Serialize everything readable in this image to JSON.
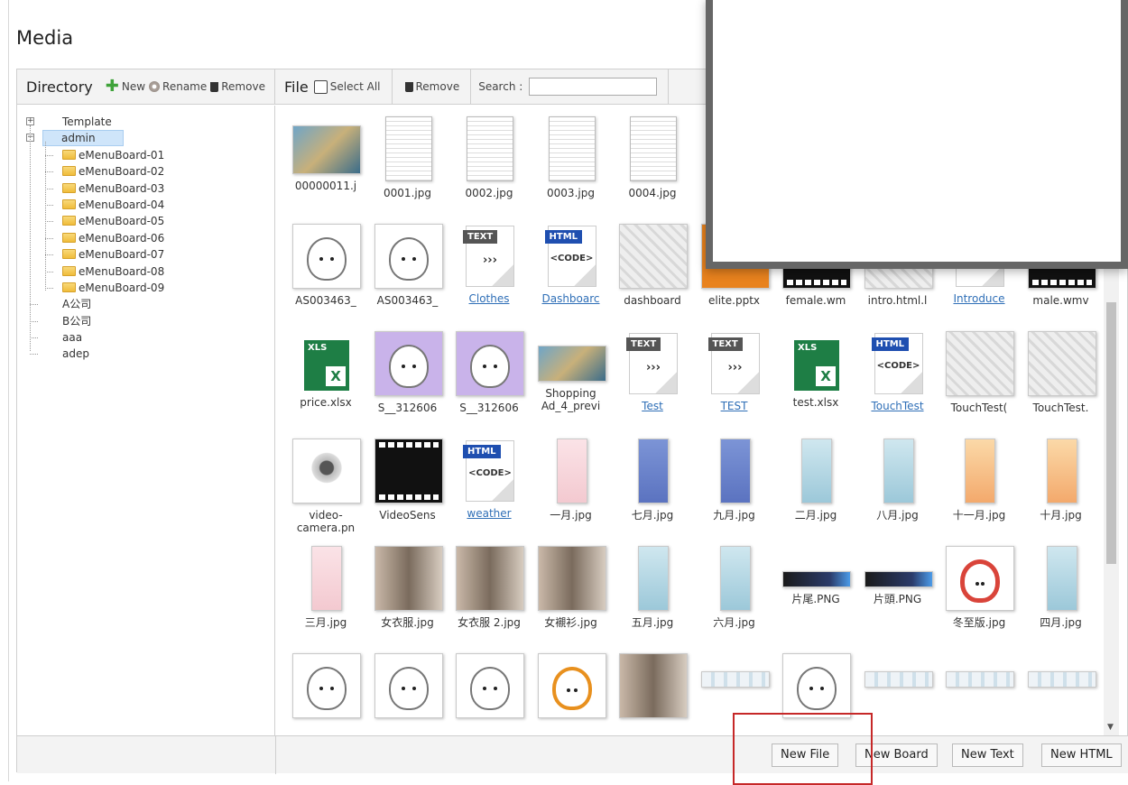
{
  "page": {
    "title": "Media"
  },
  "directory": {
    "title": "Directory",
    "new_label": "New",
    "rename_label": "Rename",
    "remove_label": "Remove",
    "tree": [
      {
        "label": "Template",
        "level": 0,
        "expander": "+"
      },
      {
        "label": "admin",
        "level": 0,
        "expander": "-",
        "selected": true
      },
      {
        "label": "eMenuBoard-01",
        "level": 1,
        "folder": true
      },
      {
        "label": "eMenuBoard-02",
        "level": 1,
        "folder": true
      },
      {
        "label": "eMenuBoard-03",
        "level": 1,
        "folder": true
      },
      {
        "label": "eMenuBoard-04",
        "level": 1,
        "folder": true
      },
      {
        "label": "eMenuBoard-05",
        "level": 1,
        "folder": true
      },
      {
        "label": "eMenuBoard-06",
        "level": 1,
        "folder": true
      },
      {
        "label": "eMenuBoard-07",
        "level": 1,
        "folder": true
      },
      {
        "label": "eMenuBoard-08",
        "level": 1,
        "folder": true
      },
      {
        "label": "eMenuBoard-09",
        "level": 1,
        "folder": true
      },
      {
        "label": "A公司",
        "level": 0
      },
      {
        "label": "B公司",
        "level": 0
      },
      {
        "label": "aaa",
        "level": 0
      },
      {
        "label": "adep",
        "level": 0
      }
    ]
  },
  "file": {
    "title": "File",
    "select_all_label": "Select All",
    "remove_label": "Remove",
    "search_label": "Search :",
    "search_value": ""
  },
  "files": [
    {
      "caption": "00000011.j",
      "kind": "photo"
    },
    {
      "caption": "0001.jpg",
      "kind": "doc"
    },
    {
      "caption": "0002.jpg",
      "kind": "doc"
    },
    {
      "caption": "0003.jpg",
      "kind": "doc"
    },
    {
      "caption": "0004.jpg",
      "kind": "doc"
    },
    {
      "caption": "",
      "kind": "hidden"
    },
    {
      "caption": "",
      "kind": "hidden"
    },
    {
      "caption": "",
      "kind": "hidden"
    },
    {
      "caption": "",
      "kind": "hidden"
    },
    {
      "caption": "",
      "kind": "hidden"
    },
    {
      "caption": "AS003463_",
      "kind": "bunny"
    },
    {
      "caption": "AS003463_",
      "kind": "bunny"
    },
    {
      "caption": "Clothes",
      "kind": "text",
      "link": true
    },
    {
      "caption": "Dashboarc",
      "kind": "html",
      "link": true
    },
    {
      "caption": "dashboard",
      "kind": "pattern"
    },
    {
      "caption": "elite.pptx",
      "kind": "ppt"
    },
    {
      "caption": "female.wm",
      "kind": "video"
    },
    {
      "caption": "intro.html.l",
      "kind": "pattern"
    },
    {
      "caption": "Introduce",
      "kind": "html",
      "link": true
    },
    {
      "caption": "male.wmv",
      "kind": "video"
    },
    {
      "caption": "price.xlsx",
      "kind": "xls"
    },
    {
      "caption": "S__312606",
      "kind": "bunny-purple"
    },
    {
      "caption": "S__312606",
      "kind": "bunny-purple"
    },
    {
      "caption": "Shopping Ad_4_previ",
      "kind": "photo-wide",
      "wrap": true
    },
    {
      "caption": "Test",
      "kind": "text",
      "link": true
    },
    {
      "caption": "TEST",
      "kind": "text",
      "link": true
    },
    {
      "caption": "test.xlsx",
      "kind": "xls"
    },
    {
      "caption": "TouchTest",
      "kind": "html",
      "link": true
    },
    {
      "caption": "TouchTest(",
      "kind": "pattern"
    },
    {
      "caption": "TouchTest.",
      "kind": "pattern"
    },
    {
      "caption": "video- camera.pn",
      "kind": "webcam",
      "wrap": true
    },
    {
      "caption": "VideoSens",
      "kind": "video"
    },
    {
      "caption": "weather",
      "kind": "html",
      "link": true
    },
    {
      "caption": "一月.jpg",
      "kind": "cal-pink"
    },
    {
      "caption": "七月.jpg",
      "kind": "cal-blue"
    },
    {
      "caption": "九月.jpg",
      "kind": "cal-blue"
    },
    {
      "caption": "二月.jpg",
      "kind": "cal"
    },
    {
      "caption": "八月.jpg",
      "kind": "cal"
    },
    {
      "caption": "十一月.jpg",
      "kind": "cal-orange"
    },
    {
      "caption": "十月.jpg",
      "kind": "cal-orange"
    },
    {
      "caption": "三月.jpg",
      "kind": "cal-pink"
    },
    {
      "caption": "女衣服.jpg",
      "kind": "fashion"
    },
    {
      "caption": "女衣服 2.jpg",
      "kind": "fashion",
      "wrap": true
    },
    {
      "caption": "女襯衫.jpg",
      "kind": "fashion"
    },
    {
      "caption": "五月.jpg",
      "kind": "cal"
    },
    {
      "caption": "六月.jpg",
      "kind": "cal"
    },
    {
      "caption": "片尾.PNG",
      "kind": "banner"
    },
    {
      "caption": "片頭.PNG",
      "kind": "banner"
    },
    {
      "caption": "冬至版.jpg",
      "kind": "bunny-red"
    },
    {
      "caption": "四月.jpg",
      "kind": "cal"
    },
    {
      "caption": "",
      "kind": "bunny"
    },
    {
      "caption": "",
      "kind": "bunny"
    },
    {
      "caption": "",
      "kind": "bunny"
    },
    {
      "caption": "",
      "kind": "bunny-orange"
    },
    {
      "caption": "",
      "kind": "fashion"
    },
    {
      "caption": "",
      "kind": "strip"
    },
    {
      "caption": "",
      "kind": "bunny"
    },
    {
      "caption": "",
      "kind": "strip"
    },
    {
      "caption": "",
      "kind": "strip"
    },
    {
      "caption": "",
      "kind": "strip"
    }
  ],
  "footer": {
    "new_file": "New File",
    "new_board": "New Board",
    "new_text": "New Text",
    "new_html": "New HTML"
  },
  "colors": {
    "accent_link": "#2f6fb7",
    "selection": "#cfe5fa",
    "highlight_box": "#c62828",
    "xls_green": "#1e7e45",
    "html_badge": "#1f4fb0",
    "text_badge": "#555555"
  }
}
